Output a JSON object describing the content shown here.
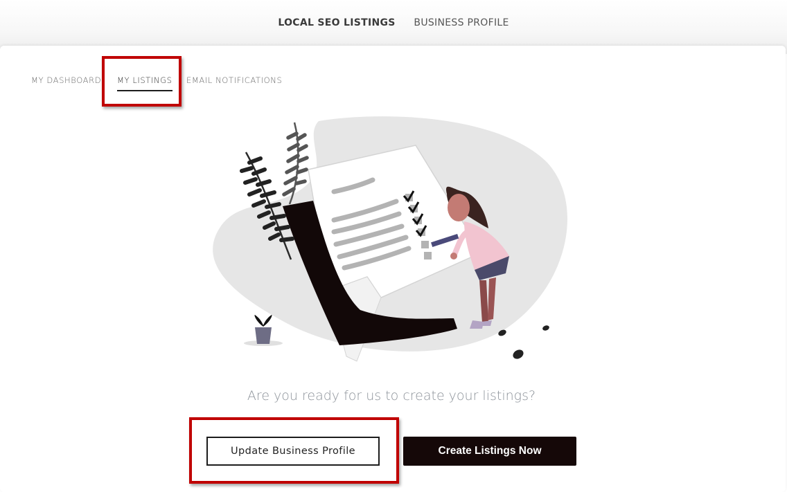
{
  "top_nav": {
    "items": [
      {
        "label": "LOCAL SEO LISTINGS",
        "active": true
      },
      {
        "label": "BUSINESS PROFILE",
        "active": false
      }
    ]
  },
  "sub_tabs": {
    "items": [
      {
        "label": "MY DASHBOARD",
        "active": false
      },
      {
        "label": "MY LISTINGS",
        "active": true
      },
      {
        "label": "EMAIL NOTIFICATIONS",
        "active": false
      }
    ]
  },
  "main": {
    "question": "Are you ready for us to create your listings?",
    "update_button_label": "Update Business Profile",
    "create_button_label": "Create Listings Now"
  },
  "colors": {
    "highlight": "#c00000",
    "primary_button_bg": "#150808",
    "question_text": "#8d939a"
  }
}
